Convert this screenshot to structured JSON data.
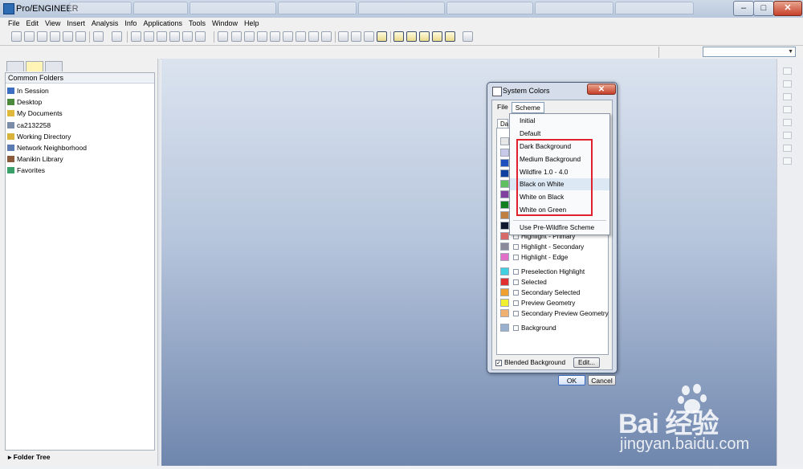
{
  "window": {
    "title": "Pro/ENGINEER",
    "background_tabs": [
      "",
      "",
      "",
      "",
      "",
      "",
      "",
      ""
    ],
    "minimize_label": "–",
    "maximize_label": "□",
    "close_label": "✕"
  },
  "menubar": [
    "File",
    "Edit",
    "View",
    "Insert",
    "Analysis",
    "Info",
    "Applications",
    "Tools",
    "Window",
    "Help"
  ],
  "navigator": {
    "header": "Common Folders",
    "items": [
      {
        "label": "In Session",
        "icon": "session-icon"
      },
      {
        "label": "Desktop",
        "icon": "desktop-icon"
      },
      {
        "label": "My Documents",
        "icon": "documents-icon"
      },
      {
        "label": "ca2132258",
        "icon": "computer-icon"
      },
      {
        "label": "Working Directory",
        "icon": "working-directory-icon"
      },
      {
        "label": "Network Neighborhood",
        "icon": "network-icon"
      },
      {
        "label": "Manikin Library",
        "icon": "manikin-icon"
      },
      {
        "label": "Favorites",
        "icon": "favorites-icon"
      }
    ],
    "footer": "Folder Tree"
  },
  "dialog": {
    "title": "System Colors",
    "close_label": "✕",
    "menus": [
      "File",
      "Scheme"
    ],
    "tab_label": "Da",
    "color_rows": [
      {
        "label": "Highlight - Primary",
        "swatch": "#d86a6a"
      },
      {
        "label": "Highlight - Secondary",
        "swatch": "#8a8a9a"
      },
      {
        "label": "Highlight - Edge",
        "swatch": "#e070c8"
      },
      {
        "label": "Preselection Highlight",
        "swatch": "#40d0e0"
      },
      {
        "label": "Selected",
        "swatch": "#e03030"
      },
      {
        "label": "Secondary Selected",
        "swatch": "#f0a030"
      },
      {
        "label": "Preview Geometry",
        "swatch": "#f0f030"
      },
      {
        "label": "Secondary Preview Geometry",
        "swatch": "#f0b070"
      },
      {
        "label": "Background",
        "swatch": "#9ab0d0"
      }
    ],
    "hidden_swatches": [
      "#e8e8e8",
      "#c8c8e8",
      "#2050c0",
      "#1040a0",
      "#60c060",
      "#8040a0",
      "#108020",
      "#c08040",
      "#101830"
    ],
    "blended_label": "Blended Background",
    "blended_checked": "✓",
    "edit_label": "Edit...",
    "ok_label": "OK",
    "cancel_label": "Cancel"
  },
  "scheme_menu": {
    "items": [
      "Initial",
      "Default",
      "Dark Background",
      "Medium Background",
      "Wildfire 1.0 - 4.0",
      "Black on White",
      "White on Black",
      "White on Green"
    ],
    "hovered_index": 5,
    "extra_item": "Use Pre-Wildfire Scheme"
  },
  "watermark": {
    "brand": "Bai 经验",
    "url": "jingyan.baidu.com"
  },
  "colors": {
    "annotation_box": "#e0202a",
    "graphics_top": "#dbe3ef",
    "graphics_bottom": "#6f86ad"
  }
}
